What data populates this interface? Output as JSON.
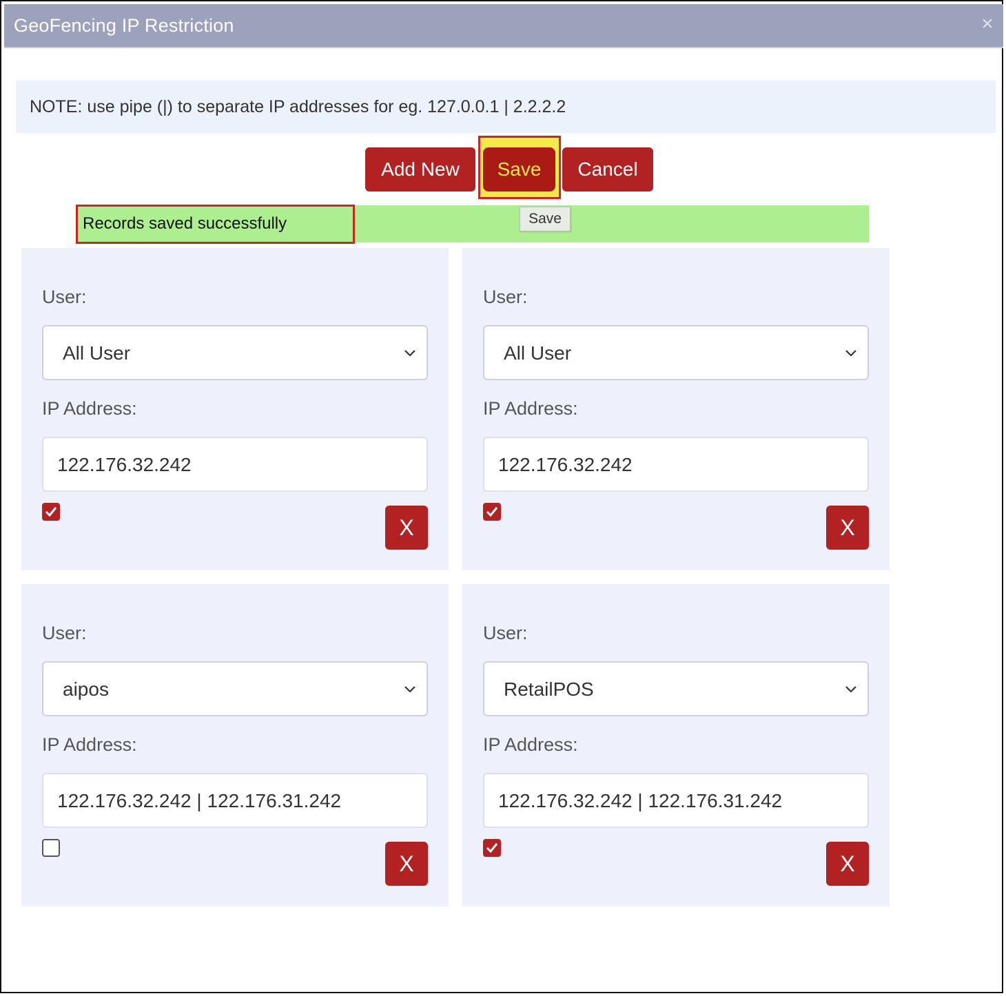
{
  "dialog": {
    "title": "GeoFencing IP Restriction",
    "close_glyph": "×"
  },
  "note": {
    "text": "NOTE: use pipe (|) to separate IP addresses for eg. 127.0.0.1 | 2.2.2.2"
  },
  "toolbar": {
    "add_new_label": "Add New",
    "save_label": "Save",
    "cancel_label": "Cancel"
  },
  "status": {
    "message": "Records saved successfully",
    "tooltip": "Save"
  },
  "colors": {
    "titlebar": "#9ca1bc",
    "button": "#b22222",
    "save_highlight": "#f5e84a",
    "success": "#adee90",
    "card": "#eef0fc"
  },
  "labels": {
    "user": "User:",
    "ip": "IP Address:"
  },
  "records": [
    {
      "user": "All User",
      "ip": "122.176.32.242",
      "enabled": true,
      "delete_label": "X"
    },
    {
      "user": "All User",
      "ip": "122.176.32.242",
      "enabled": true,
      "delete_label": "X"
    },
    {
      "user": "aipos",
      "ip": "122.176.32.242 | 122.176.31.242",
      "enabled": false,
      "delete_label": "X"
    },
    {
      "user": "RetailPOS",
      "ip": "122.176.32.242 | 122.176.31.242",
      "enabled": true,
      "delete_label": "X"
    }
  ]
}
